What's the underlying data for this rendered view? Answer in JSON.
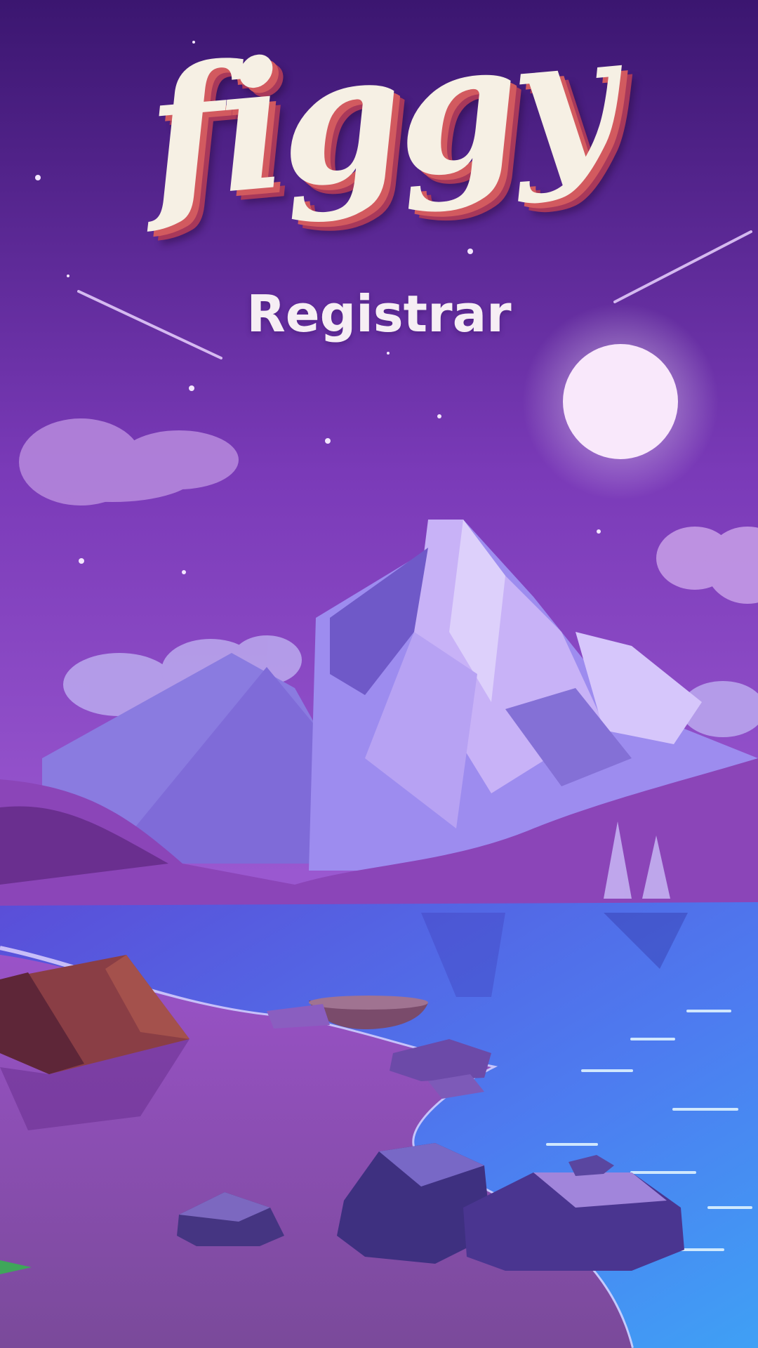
{
  "app": {
    "logo_text": "figgy",
    "screen_title": "Registrar"
  },
  "colors": {
    "logo_fill": "#f6f0e4",
    "logo_shadow": "#d25a5f",
    "title_text": "#f6eef4",
    "sky_top": "#3b1670",
    "sky_bottom": "#9c56cf",
    "water": "#4a7cf0",
    "moon": "#f9e8fb"
  },
  "scene": {
    "icons": [
      "moon-icon",
      "mountain-icon",
      "cloud-icon",
      "lake-icon",
      "tent-icon",
      "boat-icon",
      "rock-icon",
      "pine-tree-icon",
      "star-icon",
      "shooting-star-icon"
    ]
  }
}
